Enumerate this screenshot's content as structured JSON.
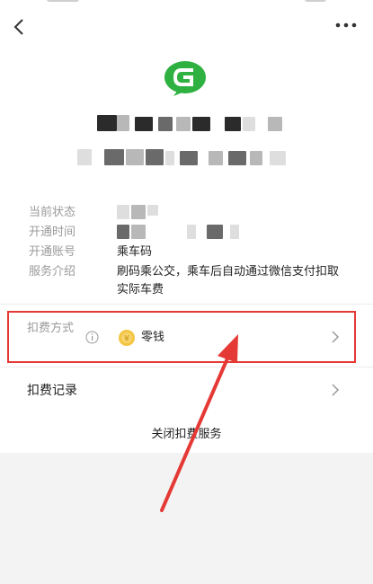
{
  "nav": {
    "back_icon": "chevron-left-icon",
    "more_icon": "more-dots-icon"
  },
  "logo": {
    "icon": "green-g-logo",
    "color": "#2fb142"
  },
  "info": {
    "status_label": "当前状态",
    "open_time_label": "开通时间",
    "account_label": "开通账号",
    "account_value": "乘车码",
    "intro_label": "服务介绍",
    "intro_value": "刷码乘公交，乘车后自动通过微信支付扣取实际车费"
  },
  "payment": {
    "label": "扣费方式",
    "method": "零钱",
    "info_icon": "info-circle-icon",
    "coin_icon": "coin-icon"
  },
  "records": {
    "label": "扣费记录"
  },
  "close": {
    "label": "关闭扣费服务"
  },
  "colors": {
    "highlight": "#e53935",
    "arrow": "#e53935"
  }
}
